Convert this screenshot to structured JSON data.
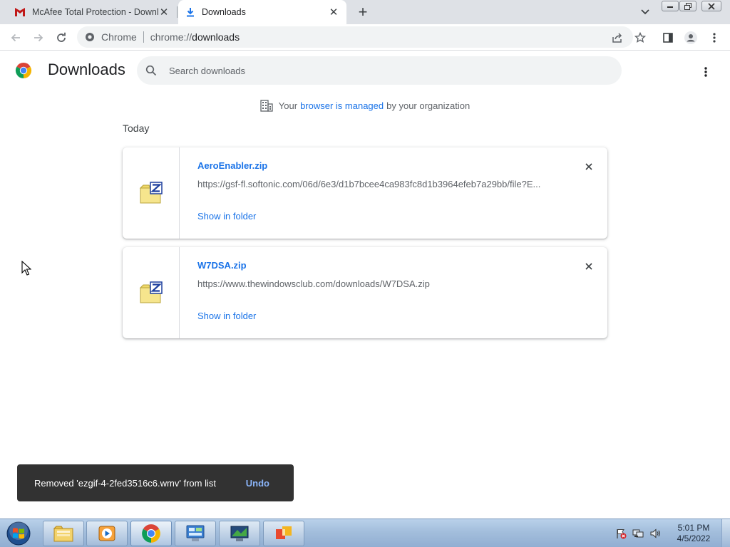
{
  "browser": {
    "tabs": [
      {
        "title": "McAfee Total Protection - Downl",
        "icon": "mcafee-icon",
        "active": false
      },
      {
        "title": "Downloads",
        "icon": "download-icon",
        "active": true
      }
    ],
    "new_tab_label": "+",
    "omnibox": {
      "site_label": "Chrome",
      "url_scheme": "chrome://",
      "url_host": "downloads"
    }
  },
  "downloads_page": {
    "title": "Downloads",
    "search_placeholder": "Search downloads",
    "managed_notice": {
      "prefix": "Your",
      "link": "browser is managed",
      "suffix": "by your organization"
    },
    "section_label": "Today",
    "items": [
      {
        "file_name": "AeroEnabler.zip",
        "url": "https://gsf-fl.softonic.com/06d/6e3/d1b7bcee4ca983fc8d1b3964efeb7a29bb/file?E...",
        "action": "Show in folder",
        "icon": "zip-file-icon"
      },
      {
        "file_name": "W7DSA.zip",
        "url": "https://www.thewindowsclub.com/downloads/W7DSA.zip",
        "action": "Show in folder",
        "icon": "zip-file-icon"
      }
    ]
  },
  "toast": {
    "message": "Removed 'ezgif-4-2fed3516c6.wmv' from list",
    "action": "Undo"
  },
  "taskbar": {
    "pinned": [
      "file-explorer-icon",
      "media-player-icon",
      "chrome-icon",
      "control-panel-icon",
      "network-icon",
      "office-icon"
    ],
    "tray_icons": [
      "action-center-flag-icon",
      "network-tray-icon",
      "volume-icon"
    ],
    "clock": {
      "time": "5:01 PM",
      "date": "4/5/2022"
    }
  },
  "colors": {
    "accent": "#1a73e8",
    "toast_bg": "#323232",
    "undo": "#8ab4f8",
    "tabstrip": "#dee1e6"
  }
}
